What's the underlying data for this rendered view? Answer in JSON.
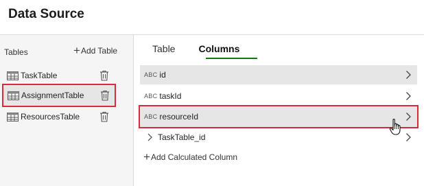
{
  "header": {
    "title": "Data Source"
  },
  "left_panel": {
    "label": "Tables",
    "add_label": "Add Table",
    "tables": [
      {
        "label": "TaskTable",
        "icon": "table-icon",
        "delete_icon": "trash-icon"
      },
      {
        "label": "AssignmentTable",
        "icon": "table-icon",
        "delete_icon": "trash-icon",
        "selected": true
      },
      {
        "label": "ResourcesTable",
        "icon": "table-icon",
        "delete_icon": "trash-icon"
      }
    ]
  },
  "tabs": [
    {
      "label": "Table",
      "active": false
    },
    {
      "label": "Columns",
      "active": true
    }
  ],
  "columns": [
    {
      "type": "ABC",
      "label": "id"
    },
    {
      "type": "ABC",
      "label": "taskId"
    },
    {
      "type": "ABC",
      "label": "resourceId",
      "selected": true
    },
    {
      "label": "TaskTable_id",
      "kind": "relation"
    }
  ],
  "add_calculated_label": "Add Calculated Column",
  "colors": {
    "accent_red": "#d72b3a",
    "tab_underline": "#0f7b0f",
    "row_shade": "#e6e6e6"
  }
}
